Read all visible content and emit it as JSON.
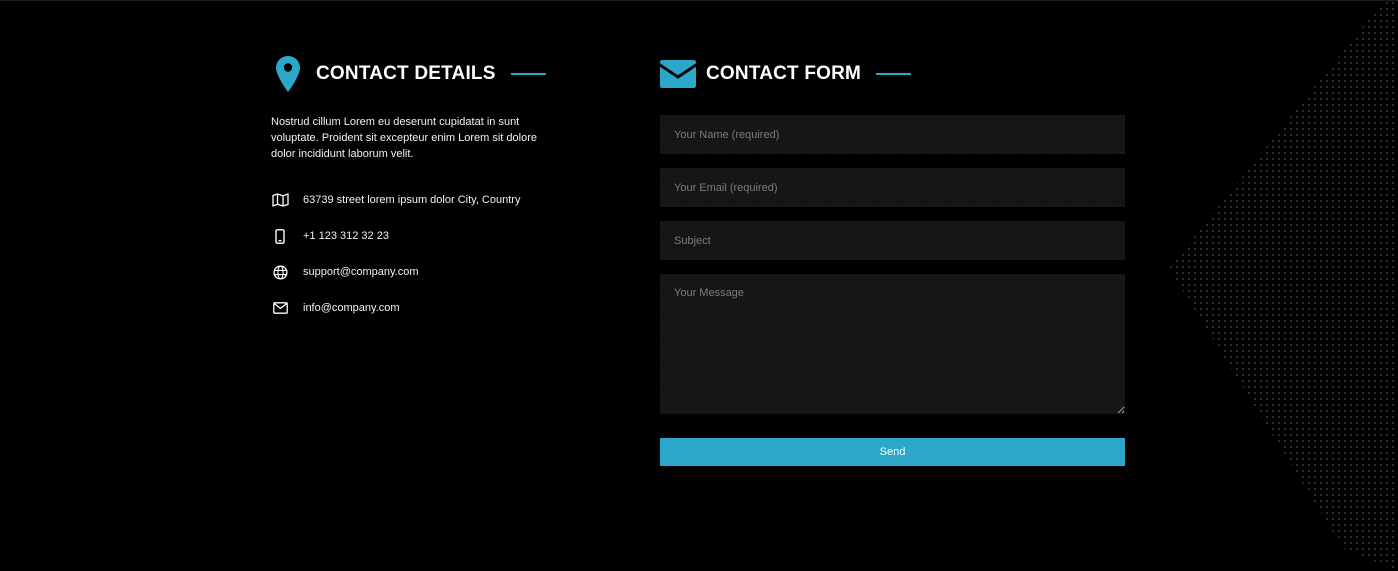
{
  "colors": {
    "accent": "#2aa7c9",
    "background": "#000000",
    "field_background": "#151515",
    "text": "#ffffff",
    "placeholder": "#7c7c7c"
  },
  "details": {
    "icon": "map-pin-icon",
    "title": "CONTACT DETAILS",
    "intro": "Nostrud cillum Lorem eu deserunt cupidatat in sunt voluptate. Proident sit excepteur enim Lorem sit dolore dolor incididunt laborum velit.",
    "items": [
      {
        "icon": "map-icon",
        "text": "63739 street lorem ipsum dolor City, Country"
      },
      {
        "icon": "mobile-phone-icon",
        "text": "+1 123 312 32 23"
      },
      {
        "icon": "globe-icon",
        "text": "support@company.com"
      },
      {
        "icon": "envelope-icon",
        "text": "info@company.com"
      }
    ]
  },
  "form": {
    "icon": "envelope-icon",
    "title": "CONTACT FORM",
    "name_placeholder": "Your Name (required)",
    "email_placeholder": "Your Email (required)",
    "subject_placeholder": "Subject",
    "message_placeholder": "Your Message",
    "name_value": "",
    "email_value": "",
    "subject_value": "",
    "message_value": "",
    "send_label": "Send"
  }
}
